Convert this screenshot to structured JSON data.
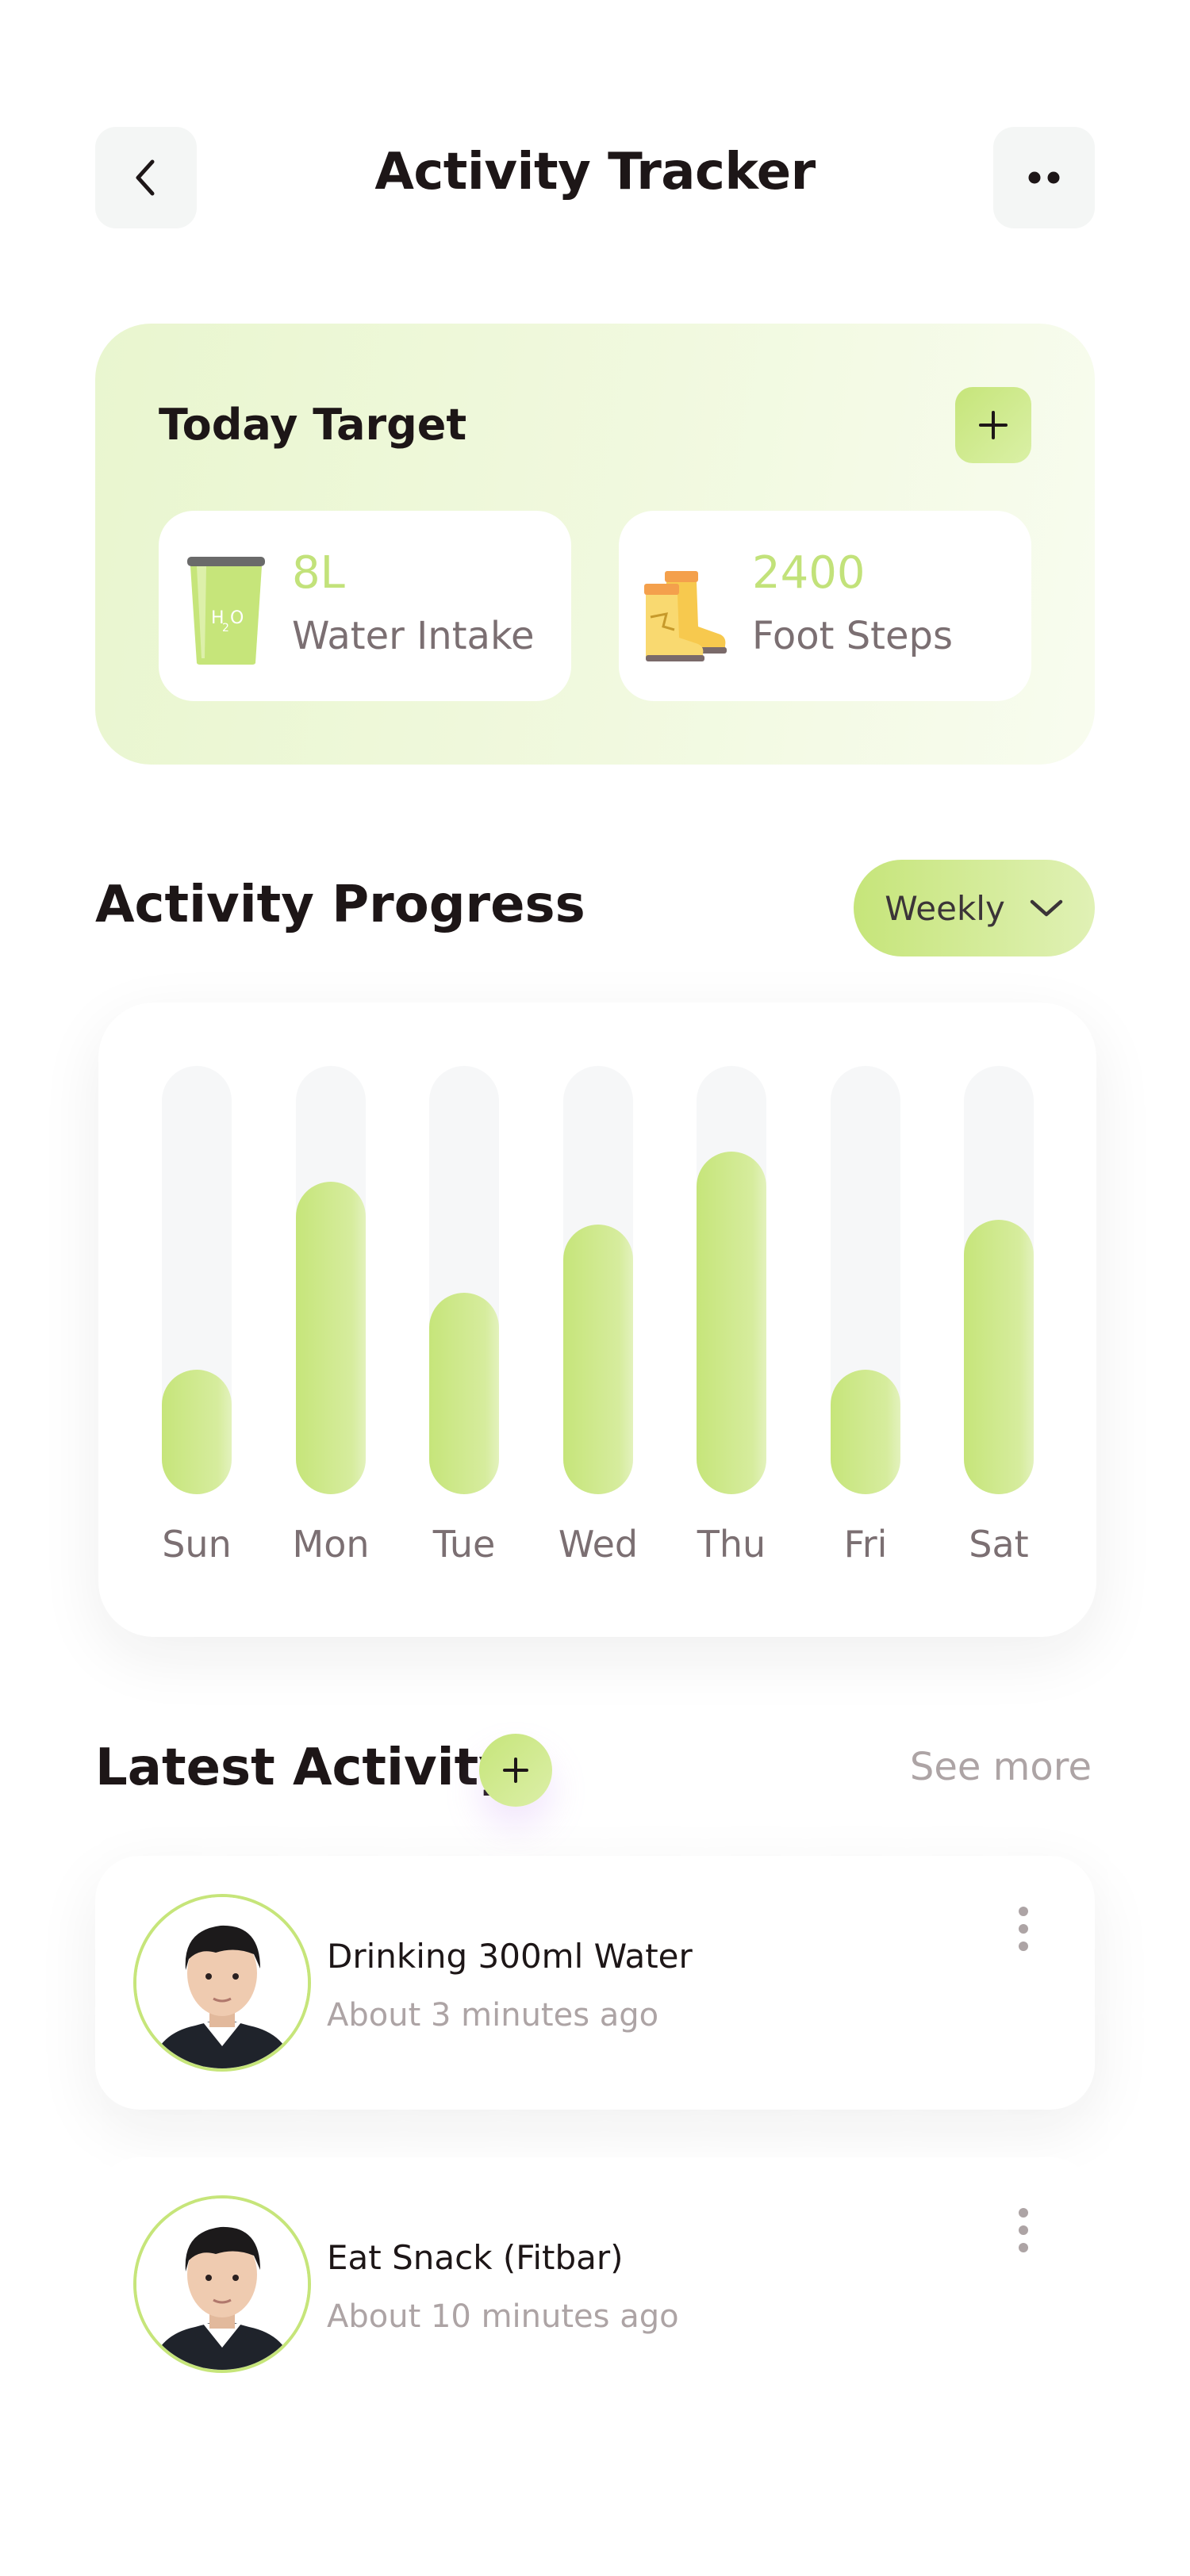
{
  "header": {
    "title": "Activity Tracker",
    "back_icon": "chevron-left-icon",
    "more_icon": "more-dots-icon"
  },
  "today_target": {
    "title": "Today Target",
    "add_icon": "plus-icon",
    "items": [
      {
        "value": "8L",
        "label": "Water Intake",
        "icon": "water-glass-icon"
      },
      {
        "value": "2400",
        "label": "Foot Steps",
        "icon": "boots-icon"
      }
    ]
  },
  "activity_progress": {
    "title": "Activity Progress",
    "period_selector": {
      "selected": "Weekly",
      "icon": "chevron-down-icon"
    }
  },
  "chart_data": {
    "type": "bar",
    "categories": [
      "Sun",
      "Mon",
      "Tue",
      "Wed",
      "Thu",
      "Fri",
      "Sat"
    ],
    "values": [
      0.29,
      0.73,
      0.47,
      0.63,
      0.8,
      0.29,
      0.64
    ],
    "ylim": [
      0,
      1
    ],
    "grid": false,
    "legend": "none"
  },
  "latest_activity": {
    "title": "Latest Activity",
    "add_icon": "plus-icon",
    "see_more": "See more",
    "items": [
      {
        "title": "Drinking 300ml Water",
        "time": "About 3 minutes ago"
      },
      {
        "title": "Eat Snack (Fitbar)",
        "time": "About 10 minutes ago"
      }
    ]
  },
  "colors": {
    "accent": "#c6e57a",
    "accent_light": "#e0f1b5",
    "text_dark": "#1d1617",
    "text_gray": "#7b6f72",
    "text_light": "#ada4a5"
  }
}
